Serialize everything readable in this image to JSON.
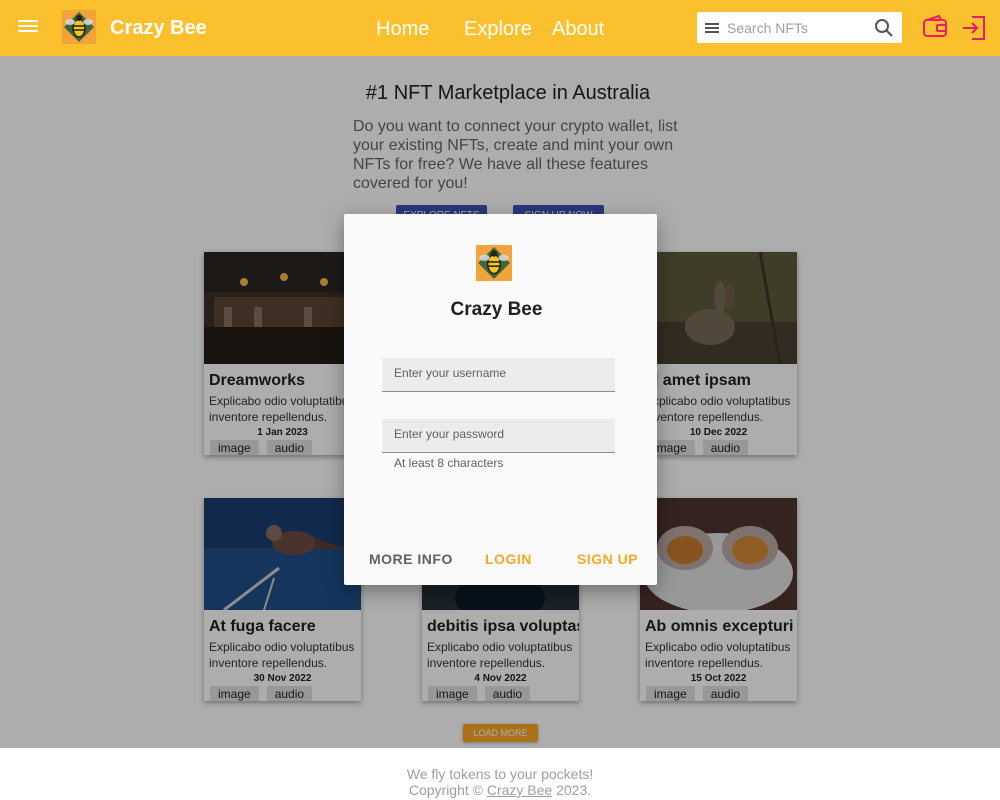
{
  "header": {
    "brand": "Crazy Bee",
    "nav": [
      "Home",
      "Explore",
      "About"
    ],
    "search_placeholder": "Search NFTs",
    "accent_color": "#fbc02d"
  },
  "icons": {
    "menu": "menu-icon",
    "logo": "bee-logo",
    "search": "search-icon",
    "filter": "lines-icon",
    "wallet": "wallet-icon",
    "login": "login-icon"
  },
  "hero": {
    "title": "#1 NFT Marketplace in Australia",
    "text": "Do you want to connect your crypto wallet, list your existing NFTs, create and mint your own NFTs for free? We have all these features covered for you!",
    "buttons": [
      "EXPLORE NFTS",
      "SIGN UP NOW"
    ]
  },
  "cards": [
    {
      "title": "Dreamworks",
      "desc": "Explicabo odio voluptatibus inventore repellendus.",
      "date": "1 Jan 2023",
      "tags": [
        "image",
        "audio"
      ]
    },
    {
      "title": "",
      "desc": "",
      "date": "",
      "tags": []
    },
    {
      "title": "el amet ipsam",
      "desc": "Explicabo odio voluptatibus inventore repellendus.",
      "date": "10 Dec 2022",
      "tags": [
        "image",
        "audio"
      ]
    },
    {
      "title": "At fuga facere",
      "desc": "Explicabo odio voluptatibus inventore repellendus.",
      "date": "30 Nov 2022",
      "tags": [
        "image",
        "audio"
      ]
    },
    {
      "title": "debitis ipsa voluptas",
      "desc": "Explicabo odio voluptatibus inventore repellendus.",
      "date": "4 Nov 2022",
      "tags": [
        "image",
        "audio"
      ]
    },
    {
      "title": "Ab omnis excepturi",
      "desc": "Explicabo odio voluptatibus inventore repellendus.",
      "date": "15 Oct 2022",
      "tags": [
        "image",
        "audio"
      ]
    }
  ],
  "load_more": "LOAD MORE",
  "footer": {
    "line1": "We fly tokens to your pockets!",
    "copyright_prefix": "Copyright ©",
    "link": "Crazy Bee",
    "year": "2023."
  },
  "dialog": {
    "title": "Crazy Bee",
    "username_placeholder": "Enter your username",
    "password_placeholder": "Enter your password",
    "password_hint": "At least 8 characters",
    "actions": {
      "more_info": "MORE INFO",
      "login": "LOGIN",
      "sign_up": "SIGN UP"
    },
    "action_colors": {
      "more_info": "#616161",
      "primary": "#f9a825"
    }
  }
}
